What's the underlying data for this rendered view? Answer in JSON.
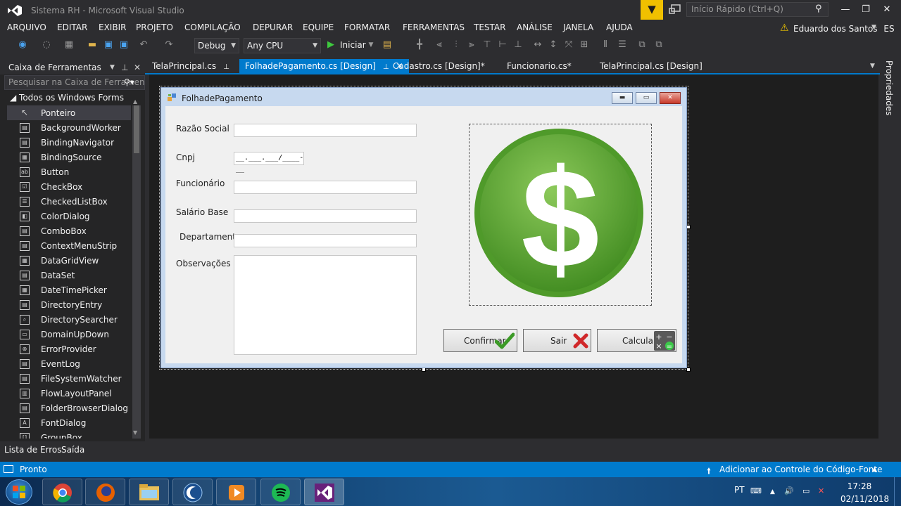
{
  "window": {
    "title": "Sistema RH - Microsoft Visual Studio",
    "quick_launch_placeholder": "Início Rápido (Ctrl+Q)"
  },
  "menu": [
    "ARQUIVO",
    "EDITAR",
    "EXIBIR",
    "PROJETO",
    "COMPILAÇÃO",
    "DEPURAR",
    "EQUIPE",
    "FORMATAR",
    "FERRAMENTAS",
    "TESTAR",
    "ANÁLISE",
    "JANELA",
    "AJUDA"
  ],
  "user": {
    "name": "Eduardo dos Santos",
    "initials": "ES"
  },
  "toolbar": {
    "config": "Debug",
    "platform": "Any CPU",
    "start_label": "Iniciar"
  },
  "toolbox": {
    "title": "Caixa de Ferramentas",
    "search_placeholder": "Pesquisar na Caixa de Ferramentas",
    "group": "Todos os Windows Forms",
    "items": [
      "Ponteiro",
      "BackgroundWorker",
      "BindingNavigator",
      "BindingSource",
      "Button",
      "CheckBox",
      "CheckedListBox",
      "ColorDialog",
      "ComboBox",
      "ContextMenuStrip",
      "DataGridView",
      "DataSet",
      "DateTimePicker",
      "DirectoryEntry",
      "DirectorySearcher",
      "DomainUpDown",
      "ErrorProvider",
      "EventLog",
      "FileSystemWatcher",
      "FlowLayoutPanel",
      "FolderBrowserDialog",
      "FontDialog",
      "GroupBox"
    ]
  },
  "tabs": [
    "TelaPrincipal.cs",
    "FolhadePagamento.cs [Design]",
    "Cadastro.cs [Design]*",
    "Funcionario.cs*",
    "TelaPrincipal.cs [Design]"
  ],
  "right_panel": {
    "label": "Propriedades"
  },
  "form": {
    "title": "FolhadePagamento",
    "labels": {
      "razao": "Razão Social",
      "cnpj": "Cnpj",
      "funcionario": "Funcionário",
      "salario": "Salário Base",
      "departamento": "Departamento",
      "observacoes": "Observações"
    },
    "cnpj_mask": "__.___.___/____-__",
    "buttons": {
      "confirmar": "Confirmar",
      "sair": "Sair",
      "calcular": "Calcular"
    }
  },
  "bottom_tabs": [
    "Lista de Erros",
    "Saída"
  ],
  "status": {
    "text": "Pronto",
    "source_control": "Adicionar ao Controle do Código-Fonte"
  },
  "taskbar": {
    "lang": "PT",
    "time": "17:28",
    "date": "02/11/2018"
  },
  "colors": {
    "accent": "#007acc",
    "ide_bg": "#2d2d30",
    "money_green": "#5aa832"
  }
}
